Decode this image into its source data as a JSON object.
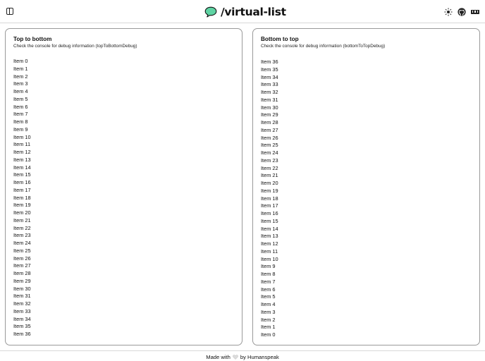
{
  "header": {
    "title": "/virtual-list",
    "icons": {
      "sidebar": "sidebar-toggle-icon",
      "logo": "speech-bubble-logo-icon",
      "theme": "sun-icon",
      "github": "github-icon",
      "npm": "npm-icon"
    },
    "colors": {
      "logo_fill": "#5fd3a3",
      "logo_stroke": "#111111"
    }
  },
  "panels": {
    "top_to_bottom": {
      "title": "Top to bottom",
      "description": "Check the console for debug information (topToBottomDebug)",
      "items": [
        "Item 0",
        "Item 1",
        "Item 2",
        "Item 3",
        "Item 4",
        "Item 5",
        "Item 6",
        "Item 7",
        "Item 8",
        "Item 9",
        "Item 10",
        "Item 11",
        "Item 12",
        "Item 13",
        "Item 14",
        "Item 15",
        "Item 16",
        "Item 17",
        "Item 18",
        "Item 19",
        "Item 20",
        "Item 21",
        "Item 22",
        "Item 23",
        "Item 24",
        "Item 25",
        "Item 26",
        "Item 27",
        "Item 28",
        "Item 29",
        "Item 30",
        "Item 31",
        "Item 32",
        "Item 33",
        "Item 34",
        "Item 35",
        "Item 36"
      ]
    },
    "bottom_to_top": {
      "title": "Bottom to top",
      "description": "Check the console for debug information (bottomToTopDebug)",
      "items": [
        "Item 36",
        "Item 35",
        "Item 34",
        "Item 33",
        "Item 32",
        "Item 31",
        "Item 30",
        "Item 29",
        "Item 28",
        "Item 27",
        "Item 26",
        "Item 25",
        "Item 24",
        "Item 23",
        "Item 22",
        "Item 21",
        "Item 20",
        "Item 19",
        "Item 18",
        "Item 17",
        "Item 16",
        "Item 15",
        "Item 14",
        "Item 13",
        "Item 12",
        "Item 11",
        "Item 10",
        "Item 9",
        "Item 8",
        "Item 7",
        "Item 6",
        "Item 5",
        "Item 4",
        "Item 3",
        "Item 2",
        "Item 1",
        "Item 0"
      ]
    }
  },
  "footer": {
    "prefix": "Made with",
    "suffix": "by Humanspeak",
    "heart_icon": "heart-icon",
    "heart_color": "#dcdcdc"
  }
}
